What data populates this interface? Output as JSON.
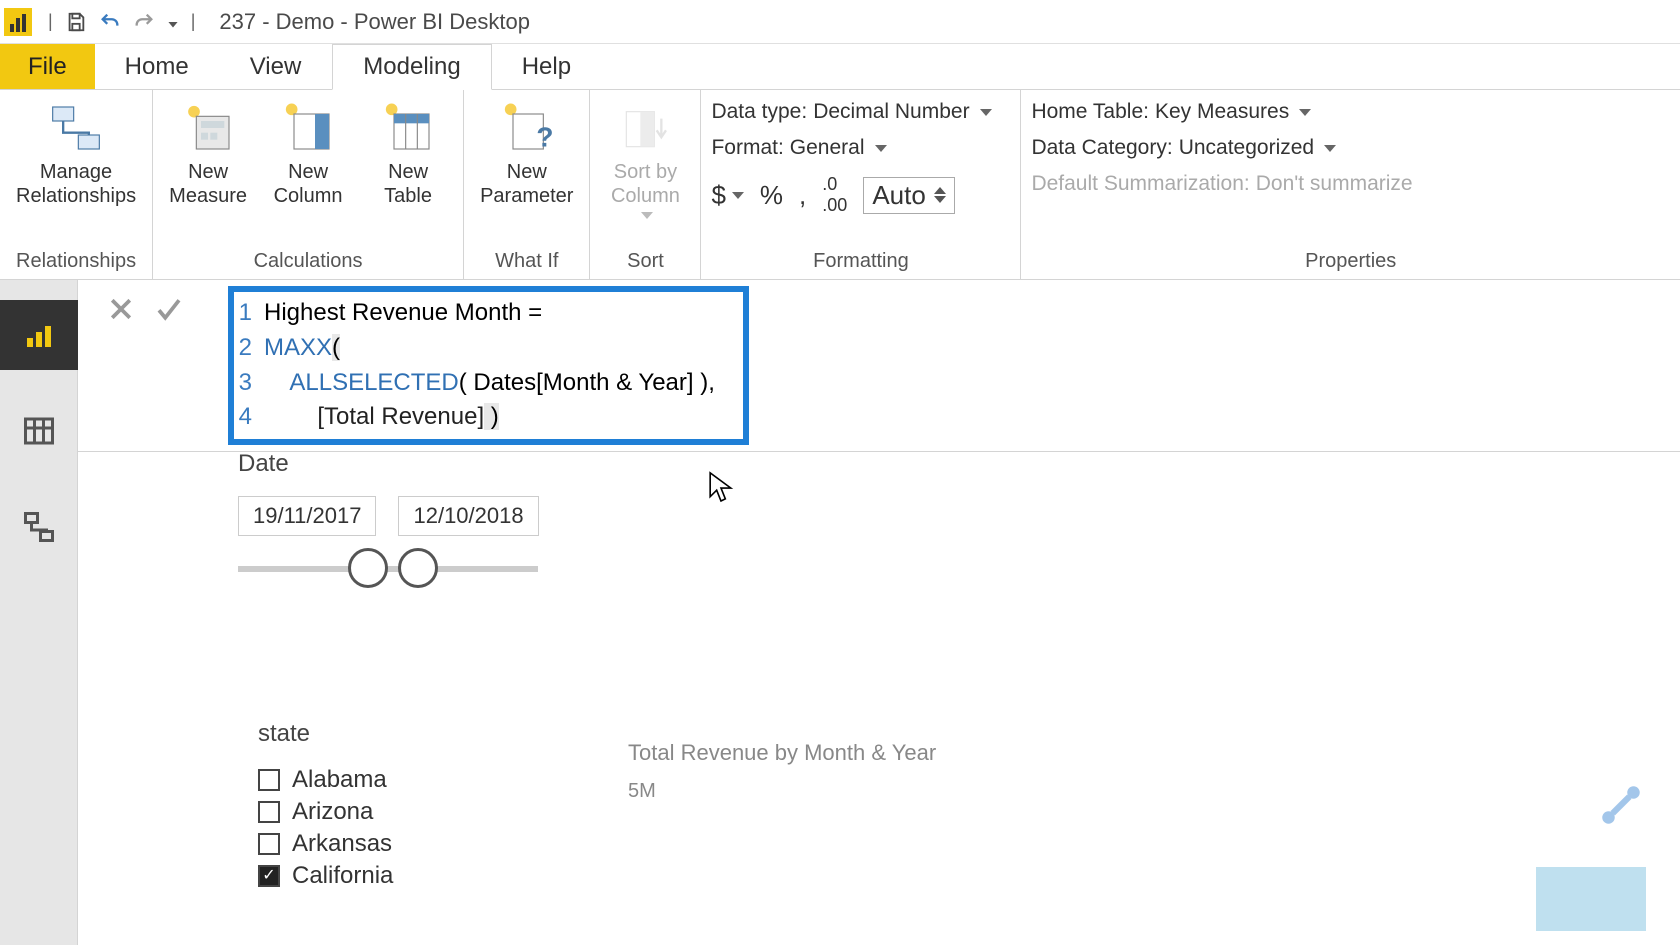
{
  "titlebar": {
    "title": "237 - Demo - Power BI Desktop"
  },
  "menu": {
    "file": "File",
    "tabs": [
      "Home",
      "View",
      "Modeling",
      "Help"
    ],
    "active_index": 2
  },
  "ribbon": {
    "groups": {
      "relationships": {
        "label": "Relationships",
        "manage": "Manage\nRelationships"
      },
      "calculations": {
        "label": "Calculations",
        "new_measure": "New\nMeasure",
        "new_column": "New\nColumn",
        "new_table": "New\nTable"
      },
      "whatif": {
        "label": "What If",
        "new_parameter": "New\nParameter"
      },
      "sort": {
        "label": "Sort",
        "sort_by": "Sort by\nColumn"
      },
      "formatting": {
        "label": "Formatting",
        "data_type_label": "Data type:",
        "data_type_value": "Decimal Number",
        "format_label": "Format:",
        "format_value": "General",
        "decimal_places": "Auto"
      },
      "properties": {
        "label": "Properties",
        "home_table_label": "Home Table:",
        "home_table_value": "Key Measures",
        "data_category_label": "Data Category:",
        "data_category_value": "Uncategorized",
        "default_sum_label": "Default Summarization:",
        "default_sum_value": "Don't summarize"
      }
    }
  },
  "formula": {
    "lines": [
      {
        "num": "1",
        "plain": "Highest Revenue Month ="
      },
      {
        "num": "2",
        "func": "MAXX",
        "rest": "("
      },
      {
        "num": "3",
        "indent": "    ",
        "func": "ALLSELECTED",
        "rest": "( Dates[Month & Year] ),"
      },
      {
        "num": "4",
        "indent": "        ",
        "ref": "[Total Revenue]",
        "close": " )"
      }
    ]
  },
  "slicers": {
    "date": {
      "title": "Date",
      "start": "19/11/2017",
      "end": "12/10/2018"
    },
    "state": {
      "title": "state",
      "items": [
        {
          "label": "Alabama",
          "checked": false
        },
        {
          "label": "Arizona",
          "checked": false
        },
        {
          "label": "Arkansas",
          "checked": false
        },
        {
          "label": "California",
          "checked": true
        }
      ]
    }
  },
  "chart": {
    "title": "Total Revenue by Month & Year",
    "y_tick": "5M"
  }
}
